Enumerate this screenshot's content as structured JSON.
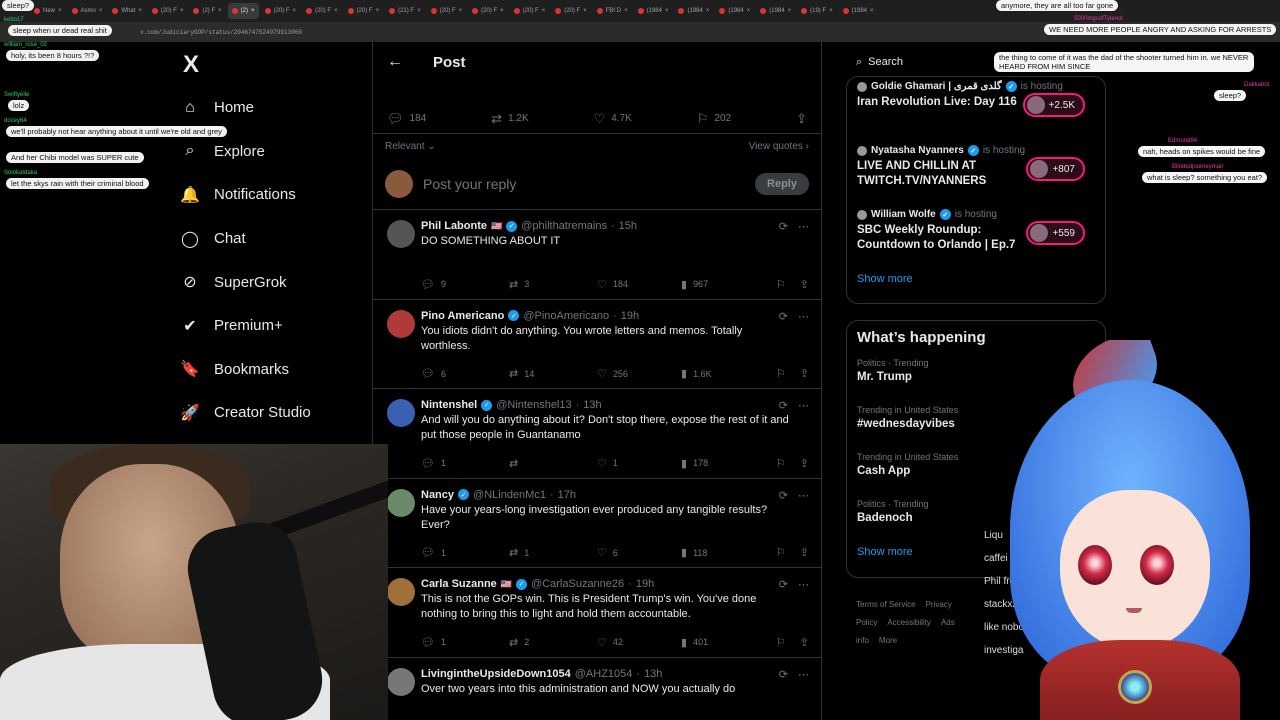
{
  "browser": {
    "tabs": [
      {
        "label": "New"
      },
      {
        "label": "Asmo"
      },
      {
        "label": "What"
      },
      {
        "label": "(20) F"
      },
      {
        "label": "(2) F"
      },
      {
        "label": "(2)",
        "active": true
      },
      {
        "label": "(20) F"
      },
      {
        "label": "(20) F"
      },
      {
        "label": "(20) F"
      },
      {
        "label": "(21) F"
      },
      {
        "label": "(20) F"
      },
      {
        "label": "(20) F"
      },
      {
        "label": "(20) F"
      },
      {
        "label": "(20) F"
      },
      {
        "label": "FBI D"
      },
      {
        "label": "(1984"
      },
      {
        "label": "(1984"
      },
      {
        "label": "(1984"
      },
      {
        "label": "(1984"
      },
      {
        "label": "(19) F"
      },
      {
        "label": "(1984"
      }
    ],
    "url": "x.com/JudiciaryGOP/status/2046747524979913060"
  },
  "nav": {
    "logo": "X",
    "items": [
      {
        "name": "home",
        "label": "Home",
        "icon": "home-icon",
        "glyph": "⌂"
      },
      {
        "name": "explore",
        "label": "Explore",
        "icon": "search-icon",
        "glyph": "⌕"
      },
      {
        "name": "notifications",
        "label": "Notifications",
        "icon": "bell-icon",
        "glyph": "🔔"
      },
      {
        "name": "chat",
        "label": "Chat",
        "icon": "chat-icon",
        "glyph": "◯"
      },
      {
        "name": "supergrok",
        "label": "SuperGrok",
        "icon": "grok-icon",
        "glyph": "⊘"
      },
      {
        "name": "premium",
        "label": "Premium+",
        "icon": "verified-icon",
        "glyph": "✔"
      },
      {
        "name": "bookmarks",
        "label": "Bookmarks",
        "icon": "bookmark-icon",
        "glyph": "🔖"
      },
      {
        "name": "creator-studio",
        "label": "Creator Studio",
        "icon": "rocket-icon",
        "glyph": "🚀"
      }
    ]
  },
  "post": {
    "header_title": "Post",
    "stats": {
      "replies": "184",
      "reposts": "1.2K",
      "likes": "4.7K",
      "bookmarks": "202"
    },
    "sort_label": "Relevant",
    "view_quotes": "View quotes",
    "reply_placeholder": "Post your reply",
    "reply_button": "Reply"
  },
  "replies": [
    {
      "name": "Phil Labonte",
      "flag": "🇺🇸",
      "verified": true,
      "handle": "@philthatremains",
      "time": "15h",
      "text": "DO SOMETHING ABOUT IT",
      "replies": "9",
      "reposts": "3",
      "likes": "184",
      "views": "967",
      "avatar_color": "#555"
    },
    {
      "name": "Pino Americano",
      "flag": "",
      "verified": true,
      "handle": "@PinoAmericano",
      "time": "19h",
      "text": "You idiots didn't do anything. You wrote letters and memos. Totally worthless.",
      "replies": "6",
      "reposts": "14",
      "likes": "256",
      "views": "1.6K",
      "avatar_color": "#b03a3a"
    },
    {
      "name": "Nintenshel",
      "flag": "",
      "verified": true,
      "handle": "@Nintenshel13",
      "time": "13h",
      "text": "And will you do anything about it? Don't stop there, expose the rest of it and put those people in Guantanamo",
      "replies": "1",
      "reposts": "",
      "likes": "1",
      "views": "178",
      "avatar_color": "#3b5fb5"
    },
    {
      "name": "Nancy",
      "flag": "",
      "verified": true,
      "handle": "@NLindenMc1",
      "time": "17h",
      "text": "Have your years-long investigation ever produced any tangible results? Ever?",
      "replies": "1",
      "reposts": "1",
      "likes": "6",
      "views": "118",
      "avatar_color": "#6a8a6a"
    },
    {
      "name": "Carla Suzanne",
      "flag": "🇺🇸",
      "verified": true,
      "handle": "@CarlaSuzanne26",
      "time": "19h",
      "text": "This is not the GOPs win. This is President Trump's win. You've done nothing to bring this to light and hold them accountable.",
      "replies": "1",
      "reposts": "2",
      "likes": "42",
      "views": "401",
      "avatar_color": "#a0703a"
    },
    {
      "name": "LivingintheUpsideDown1054",
      "flag": "",
      "verified": false,
      "handle": "@AHZ1054",
      "time": "13h",
      "text": "Over two years into this administration and NOW you actually do",
      "replies": "",
      "reposts": "",
      "likes": "",
      "views": "",
      "avatar_color": "#777"
    }
  ],
  "right": {
    "search_placeholder": "Search",
    "spaces": [
      {
        "host": "Goldie Ghamari | گلدی قمری",
        "hosting": "is hosting",
        "title": "Iran Revolution Live: Day 116",
        "count": "+2.5K"
      },
      {
        "host": "Nyatasha Nyanners",
        "hosting": "is hosting",
        "title": "LIVE AND CHILLIN AT TWITCH.TV/NYANNERS",
        "count": "+807"
      },
      {
        "host": "William Wolfe",
        "hosting": "is hosting",
        "title": "SBC Weekly Roundup: Countdown to Orlando | Ep.7",
        "count": "+559"
      }
    ],
    "spaces_show_more": "Show more",
    "happening_title": "What’s happening",
    "trends": [
      {
        "context": "Politics · Trending",
        "name": "Mr. Trump"
      },
      {
        "context": "Trending in United States",
        "name": "#wednesdayvibes"
      },
      {
        "context": "Trending in United States",
        "name": "Cash App"
      },
      {
        "context": "Politics · Trending",
        "name": "Badenoch"
      }
    ],
    "trends_show_more": "Show more",
    "footer": [
      "Terms of Service",
      "Privacy Policy",
      "Accessibility",
      "Ads info",
      "More"
    ]
  },
  "chat_left": [
    {
      "user": "",
      "text": "sleep?"
    },
    {
      "user": "kebo17",
      "text": "sleep when ur dead real shit"
    },
    {
      "user": "william_rose_02",
      "text": "holy, its been 8 hours ?!?"
    },
    {
      "user": "Swiftyelle",
      "text": "lolz"
    },
    {
      "user": "docey64",
      "text": "we'll probably not hear anything about it until we're old and grey"
    },
    {
      "user": "",
      "text": "And her Chibi model was SUPER cute"
    },
    {
      "user": "Solokatdaka",
      "text": "let the skys rain with their criminal blood"
    }
  ],
  "chat_right": [
    {
      "user": "",
      "text": "anymore, they are all too far gone"
    },
    {
      "user": "5000mgsofTylenol",
      "text": "WE NEED MORE PEOPLE ANGRY AND ASKING FOR ARRESTS"
    },
    {
      "user": "",
      "text": "the thing to come of it was the dad of the shooter turned him in. we NEVER HEARD FROM HIM SINCE"
    },
    {
      "user": "Dakkabot",
      "text": "sleep?"
    },
    {
      "user": "Edmund84",
      "text": "nah, heads on spikes would be fine"
    },
    {
      "user": "Blindedjourneyman",
      "text": "what is sleep? something you eat?"
    }
  ],
  "stream_chat": [
    {
      "text": "Liqu"
    },
    {
      "text": "caffei"
    },
    {
      "text": "Phil fro"
    },
    {
      "text": "stackxz9: its h"
    },
    {
      "text": "like nobody"
    },
    {
      "text": "investiga"
    }
  ],
  "colors": {
    "accent": "#1d9bf0",
    "live_pink": "#f91880",
    "bg": "#000000",
    "muted": "#71767b"
  }
}
